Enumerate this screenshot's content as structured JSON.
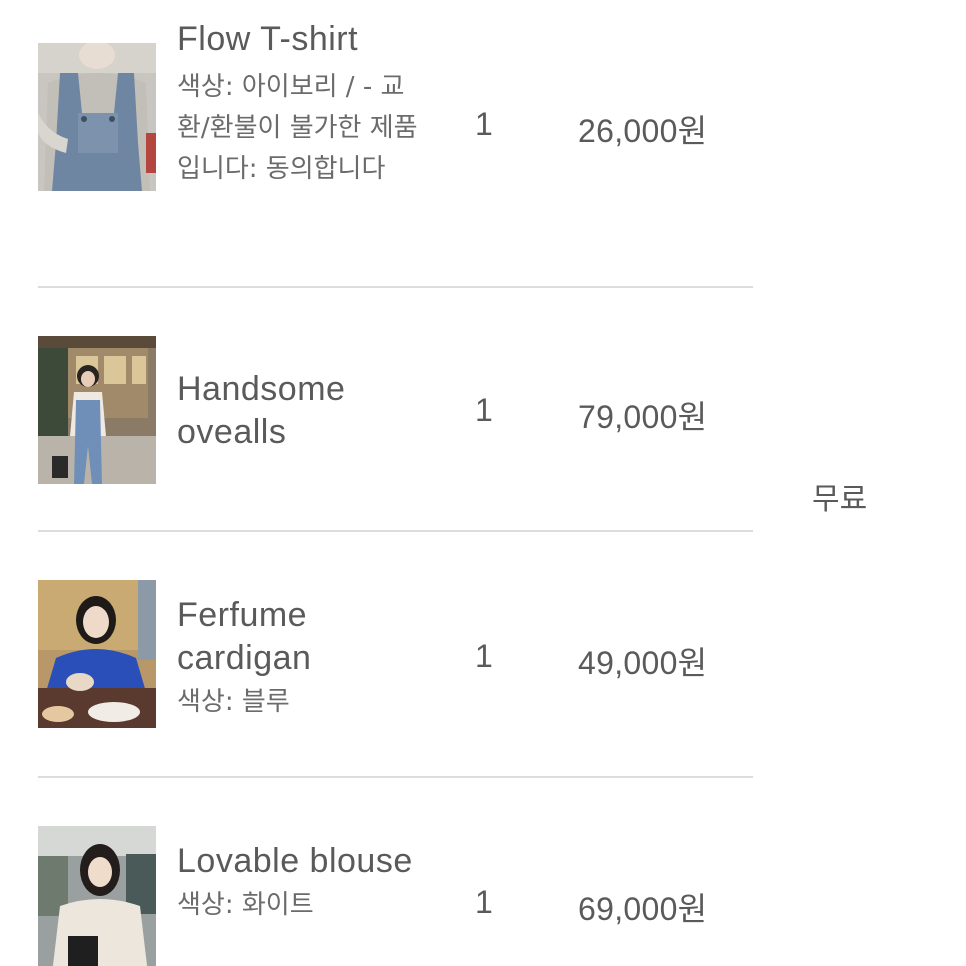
{
  "cart": {
    "items": [
      {
        "name": "Flow T-shirt",
        "option": "색상: 아이보리 / - 교환/환불이 불가한 제품입니다: 동의합니다",
        "quantity": "1",
        "price": "26,000원",
        "image_icon": "product-photo-denim-overall-sweater"
      },
      {
        "name": "Handsome ovealls",
        "option": "",
        "quantity": "1",
        "price": "79,000원",
        "image_icon": "product-photo-overalls-street"
      },
      {
        "name": "Ferfume cardigan",
        "option": "색상: 블루",
        "quantity": "1",
        "price": "49,000원",
        "image_icon": "product-photo-blue-cardigan-cafe"
      },
      {
        "name": "Lovable blouse",
        "option": "색상: 화이트",
        "quantity": "1",
        "price": "69,000원",
        "image_icon": "product-photo-white-blouse-car"
      }
    ],
    "shipping_fee": "무료"
  },
  "colors": {
    "text": "#5a5a5a",
    "option_text": "#6b6b6b",
    "divider": "#dcdcdc",
    "background": "#ffffff"
  }
}
